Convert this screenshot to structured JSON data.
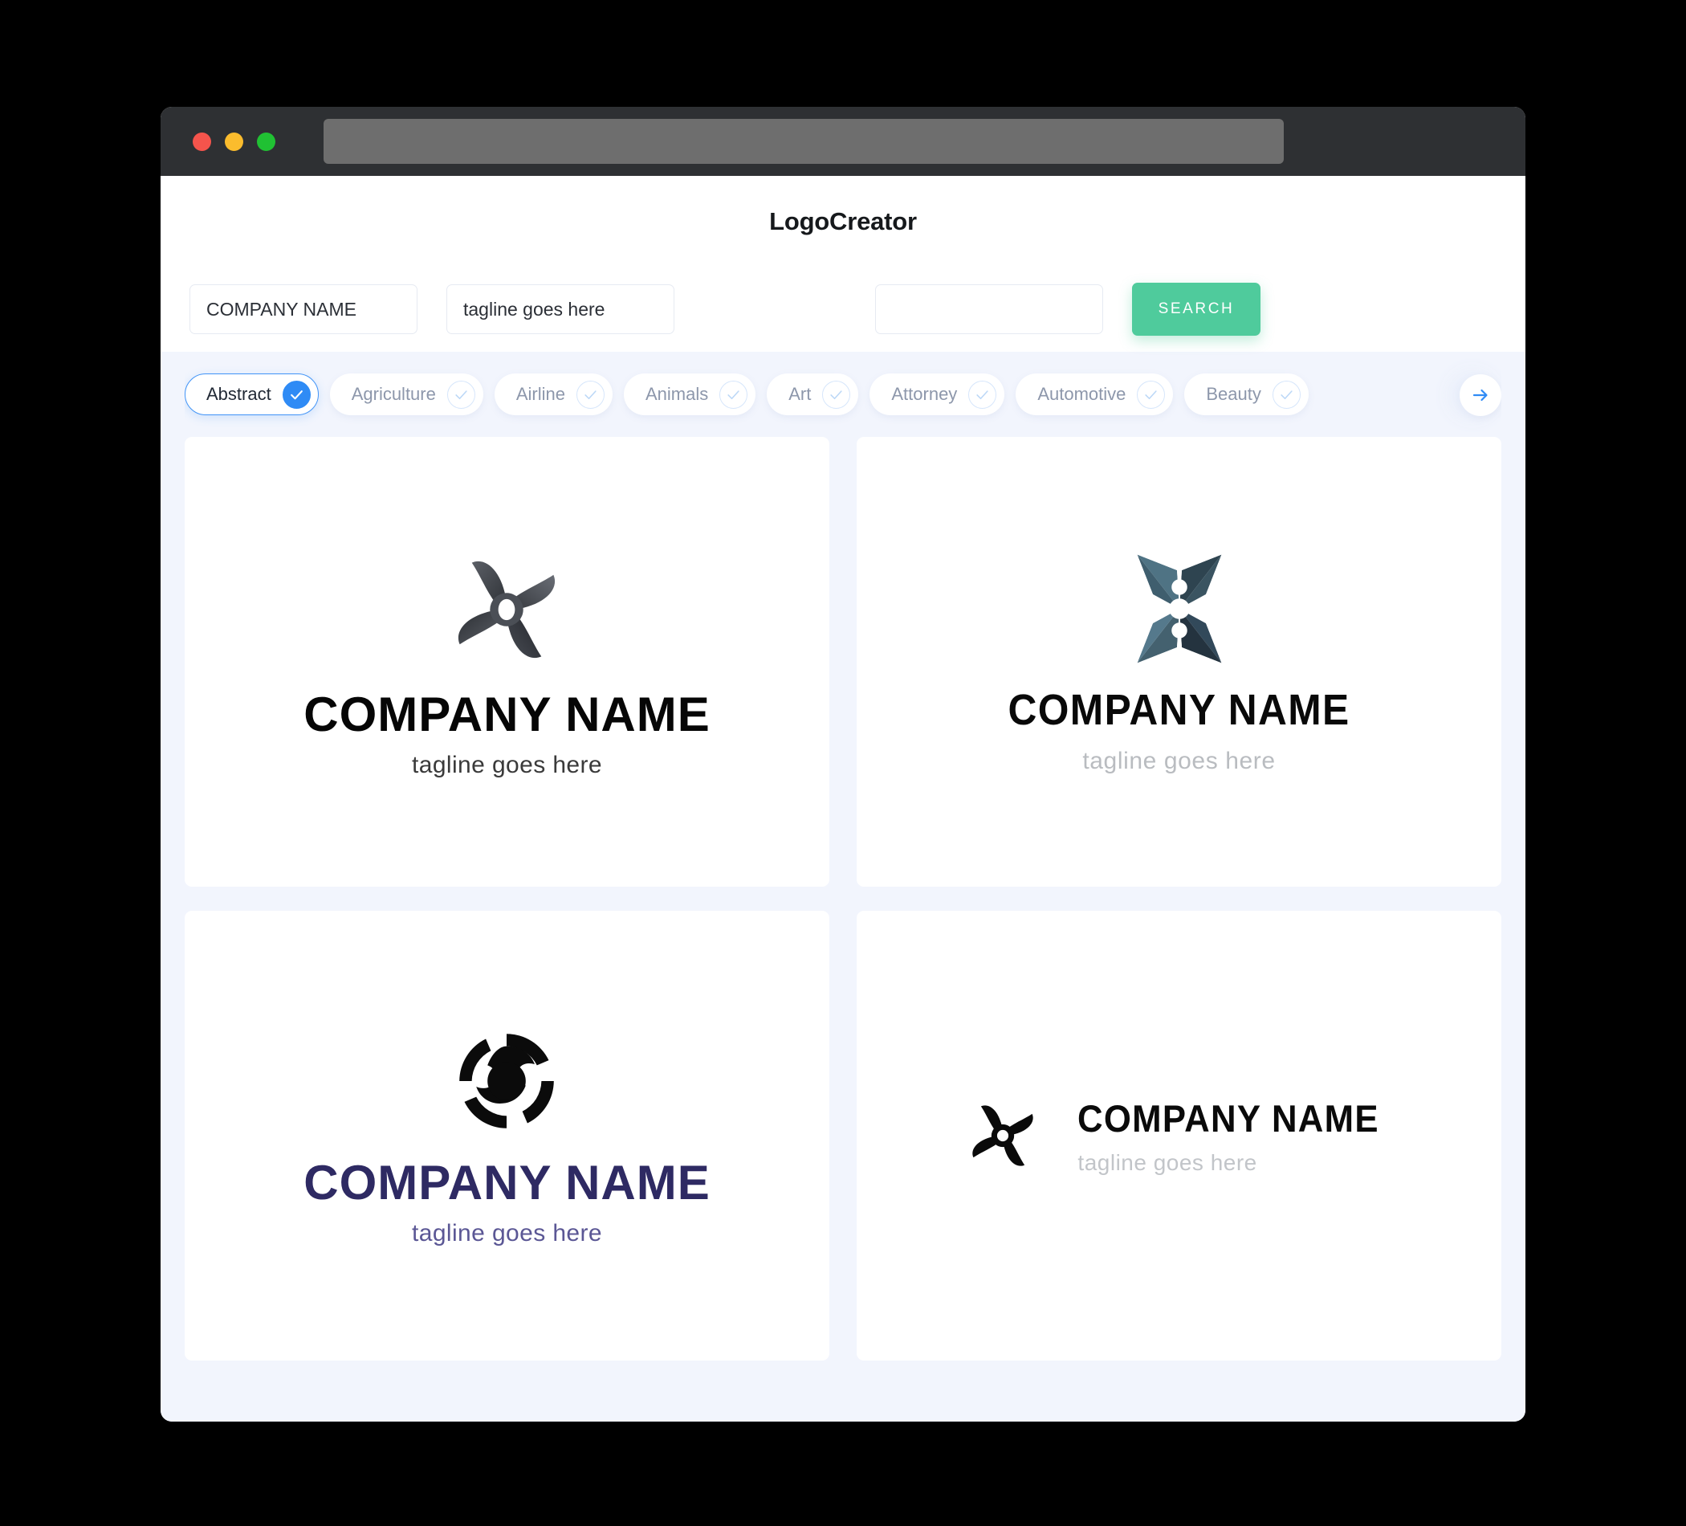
{
  "window": {
    "traffic_lights": [
      {
        "name": "close",
        "color": "#f5544c"
      },
      {
        "name": "minimize",
        "color": "#fbbc2d"
      },
      {
        "name": "maximize",
        "color": "#20c133"
      }
    ],
    "url_bar_value": ""
  },
  "header": {
    "brand_title": "LogoCreator"
  },
  "search": {
    "company_name_value": "COMPANY NAME",
    "company_name_placeholder": "COMPANY NAME",
    "tagline_value": "tagline goes here",
    "tagline_placeholder": "tagline goes here",
    "keyword_value": "",
    "keyword_placeholder": "",
    "search_button_label": "SEARCH",
    "search_button_color": "#4fcb9c"
  },
  "categories": {
    "selected": "Abstract",
    "accent_color": "#2f8bf5",
    "next_icon": "arrow-right-icon",
    "items": [
      {
        "label": "Abstract",
        "selected": true
      },
      {
        "label": "Agriculture",
        "selected": false
      },
      {
        "label": "Airline",
        "selected": false
      },
      {
        "label": "Animals",
        "selected": false
      },
      {
        "label": "Art",
        "selected": false
      },
      {
        "label": "Attorney",
        "selected": false
      },
      {
        "label": "Automotive",
        "selected": false
      },
      {
        "label": "Beauty",
        "selected": false
      }
    ]
  },
  "results": {
    "cards": [
      {
        "mark": "propeller-gray-icon",
        "name": "COMPANY NAME",
        "tagline": "tagline goes here",
        "name_color": "#060606",
        "tagline_color": "#3a3a3a",
        "layout": "stacked"
      },
      {
        "mark": "four-point-star-slate-icon",
        "name": "COMPANY NAME",
        "tagline": "tagline goes here",
        "name_color": "#090909",
        "tagline_color": "#b9bcc0",
        "layout": "stacked"
      },
      {
        "mark": "circular-swirl-black-icon",
        "name": "COMPANY NAME",
        "tagline": "tagline goes here",
        "name_color": "#2e2a63",
        "tagline_color": "#5b5795",
        "layout": "stacked"
      },
      {
        "mark": "pinwheel-black-icon",
        "name": "COMPANY NAME",
        "tagline": "tagline goes here",
        "name_color": "#0a0a0a",
        "tagline_color": "#c2c5c9",
        "layout": "horizontal"
      }
    ]
  }
}
